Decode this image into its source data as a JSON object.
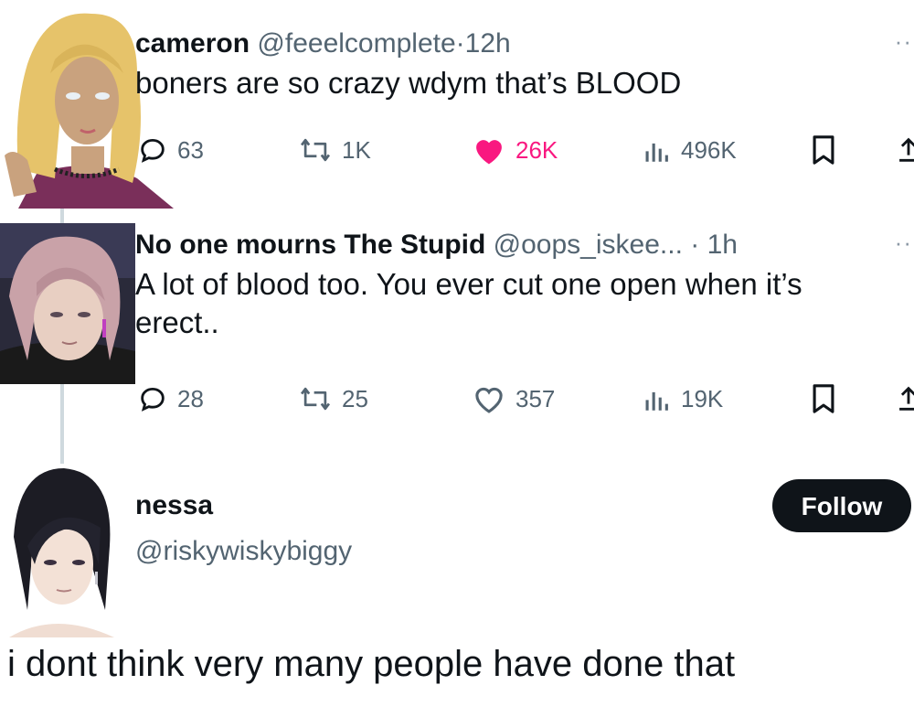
{
  "tweet1": {
    "name": "cameron",
    "handle": "@feeelcomplete",
    "sep": "·",
    "time": "12h",
    "more": "··",
    "text": "boners are so crazy wdym that’s BLOOD",
    "replies": "63",
    "retweets": "1K",
    "likes": "26K",
    "views": "496K",
    "liked": true
  },
  "tweet2": {
    "name": "No one mourns The Stupid",
    "handle": "@oops_iskee...",
    "sep": "·",
    "time": "1h",
    "more": "··",
    "text": "A lot of blood too. You ever cut one open when it’s erect..",
    "replies": "28",
    "retweets": "25",
    "likes": "357",
    "views": "19K",
    "liked": false
  },
  "tweet3": {
    "name": "nessa",
    "handle": "@riskywiskybiggy",
    "follow_label": "Follow",
    "text": "i dont think very many people have done that"
  },
  "colors": {
    "like": "#f91880",
    "muted": "#536471",
    "text": "#0f1419",
    "follow_bg": "#0f1419"
  }
}
